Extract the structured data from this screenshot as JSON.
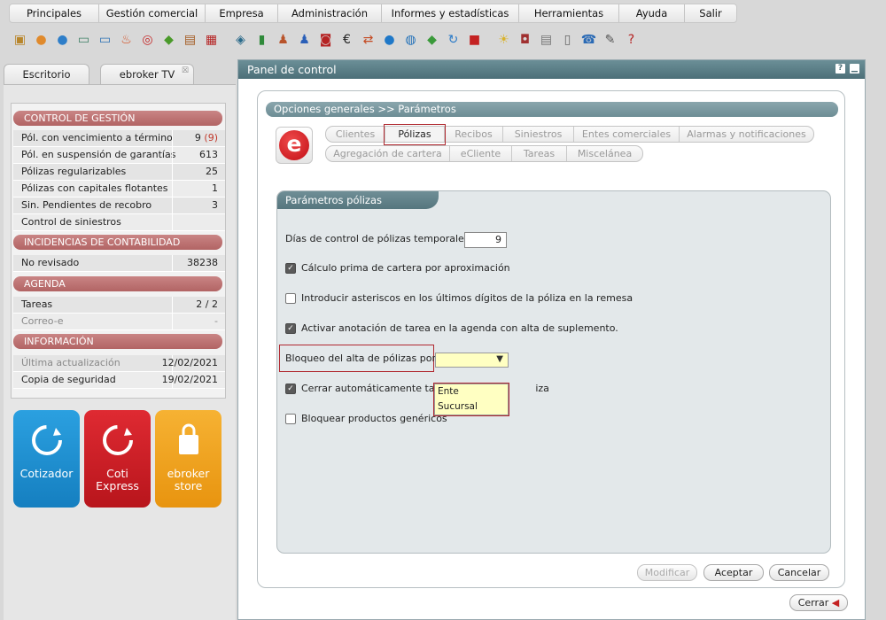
{
  "menu": [
    "Principales",
    "Gestión comercial",
    "Empresa",
    "Administración",
    "Informes y estadísticas",
    "Herramientas",
    "Ayuda",
    "Salir"
  ],
  "toolbar_icons": [
    "package-icon",
    "user-orange-icon",
    "user-blue-icon",
    "card-icon",
    "card-blue-icon",
    "fire-icon",
    "target-icon",
    "tag-icon",
    "briefcase-icon",
    "bag-icon",
    "gift-icon",
    "building-icon",
    "person-red-icon",
    "person-blue-icon",
    "car-icon",
    "euro-icon",
    "exchange-icon",
    "circle-e-icon",
    "globe-icon",
    "diamond-icon",
    "refresh-icon",
    "g-icon",
    "bulb-icon",
    "camera-icon",
    "note-icon",
    "document-icon",
    "phone-icon",
    "wrench-icon",
    "help-icon"
  ],
  "tabs": [
    {
      "label": "Escritorio"
    },
    {
      "label": "ebroker TV",
      "close": "☒"
    }
  ],
  "sidebar": {
    "control": {
      "title": "CONTROL DE GESTIÓN",
      "rows": [
        {
          "label": "Pól. con vencimiento a término",
          "value": "9",
          "extra": "(9)"
        },
        {
          "label": "Pól. en suspensión de garantías",
          "value": "613"
        },
        {
          "label": "Pólizas regularizables",
          "value": "25"
        },
        {
          "label": "Pólizas con capitales flotantes",
          "value": "1"
        },
        {
          "label": "Sin. Pendientes de recobro",
          "value": "3"
        },
        {
          "label": "Control de siniestros",
          "value": ""
        }
      ]
    },
    "contabilidad": {
      "title": "INCIDENCIAS DE CONTABILIDAD",
      "rows": [
        {
          "label": "No revisado",
          "value": "38238"
        }
      ]
    },
    "agenda": {
      "title": "AGENDA",
      "rows": [
        {
          "label": "Tareas",
          "value": "2 / 2"
        },
        {
          "label": "Correo-e",
          "value": "-"
        }
      ]
    },
    "info": {
      "title": "INFORMACIÓN",
      "rows": [
        {
          "label": "Última actualización",
          "value": "12/02/2021"
        },
        {
          "label": "Copia de seguridad",
          "value": "19/02/2021"
        }
      ]
    },
    "tiles": [
      {
        "label1": "Cotizador",
        "label2": "",
        "color": "#1a8fcf"
      },
      {
        "label1": "Coti",
        "label2": "Express",
        "color": "#cc1f27"
      },
      {
        "label1": "ebroker",
        "label2": "store",
        "color": "#f0a21c"
      }
    ]
  },
  "dialog": {
    "title": "Panel de control",
    "breadcrumb": "Opciones generales >> Parámetros",
    "logo_letter": "e",
    "tabs_row1": [
      "Clientes",
      "Pólizas",
      "Recibos",
      "Siniestros",
      "Entes comerciales",
      "Alarmas y notificaciones"
    ],
    "tabs_row2": [
      "Agregación de cartera",
      "eCliente",
      "Tareas",
      "Miscelánea"
    ],
    "selected_tab": "Pólizas",
    "section_title": "Parámetros pólizas",
    "dias_label": "Días de control de pólizas temporales",
    "dias_value": "9",
    "checks": [
      {
        "label": "Cálculo prima de cartera por aproximación",
        "checked": true
      },
      {
        "label": "Introducir asteriscos en los últimos dígitos de la póliza en la remesa",
        "checked": false
      },
      {
        "label": "Activar anotación de tarea en la agenda con alta de suplemento.",
        "checked": true
      },
      {
        "label": "Cerrar automáticamente tarea",
        "label_tail": "iza",
        "checked": true
      },
      {
        "label": "Bloquear productos genéricos",
        "checked": false
      }
    ],
    "bloqueo_label": "Bloqueo del alta de pólizas por",
    "bloqueo_value": "",
    "dropdown_options": [
      "Ente",
      "Sucursal"
    ],
    "buttons": {
      "modificar": "Modificar",
      "aceptar": "Aceptar",
      "cancelar": "Cancelar",
      "cerrar": "Cerrar"
    }
  }
}
